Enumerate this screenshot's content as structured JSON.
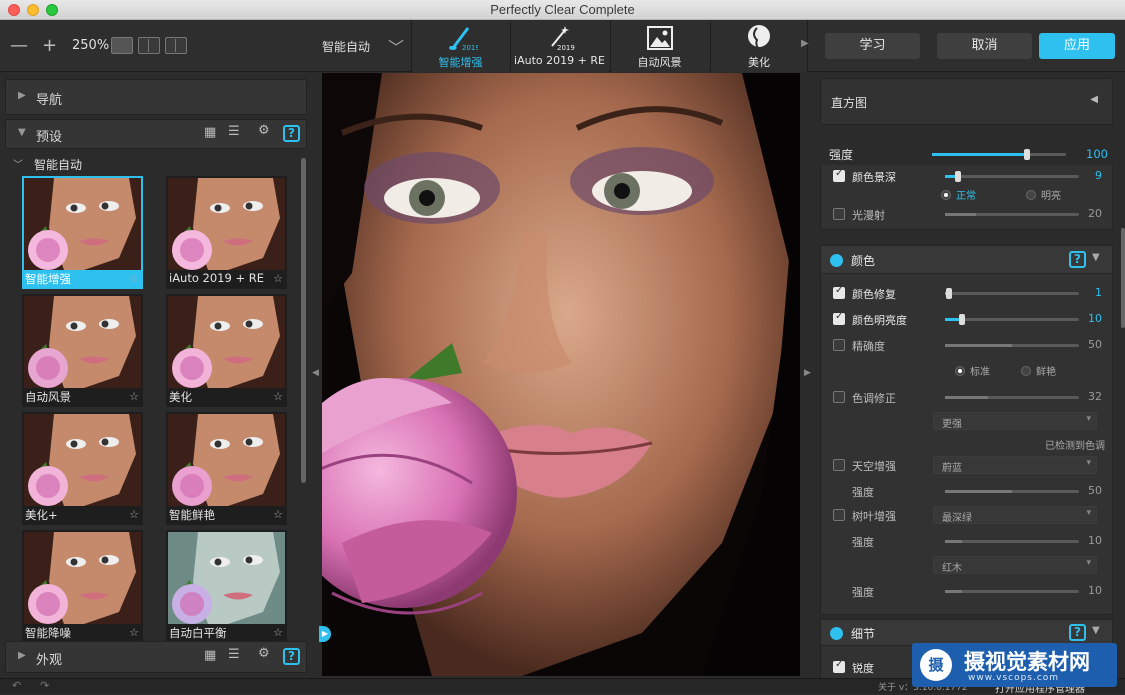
{
  "window": {
    "title": "Perfectly Clear Complete"
  },
  "toolbar": {
    "zoom_out": "—",
    "zoom_in": "+",
    "zoom_level": "250%",
    "preset_selector": "智能自动",
    "tabs": [
      {
        "label": "智能增强",
        "badge": "2019",
        "icon": "brush-2019-icon",
        "active": true
      },
      {
        "label": "iAuto 2019 + RE",
        "badge": "2019",
        "icon": "wand-2019-icon",
        "active": false
      },
      {
        "label": "自动风景",
        "icon": "landscape-icon",
        "active": false
      },
      {
        "label": "美化",
        "icon": "face-icon",
        "active": false
      }
    ],
    "learn_label": "学习",
    "cancel_label": "取消",
    "apply_label": "应用"
  },
  "left_panel": {
    "navigator": "导航",
    "presets": "预设",
    "presets_help": "?",
    "group": "智能自动",
    "thumbnails": [
      {
        "label": "智能增强",
        "selected": true
      },
      {
        "label": "iAuto 2019 + RE",
        "selected": false
      },
      {
        "label": "自动风景",
        "selected": false
      },
      {
        "label": "美化",
        "selected": false
      },
      {
        "label": "美化+",
        "selected": false
      },
      {
        "label": "智能鲜艳",
        "selected": false
      },
      {
        "label": "智能降噪",
        "selected": false
      },
      {
        "label": "自动白平衡",
        "selected": false
      }
    ],
    "star": "☆",
    "appearance": "外观",
    "appearance_help": "?"
  },
  "right_panel": {
    "histogram": "直方图",
    "strength_label": "强度",
    "strength_value": "100",
    "strength_level": 0.71,
    "sections": {
      "top": {
        "rows": [
          {
            "label": "颜色景深",
            "value": "9",
            "checked": true,
            "level": 0.1
          },
          {
            "label": "光漫射",
            "value": "20",
            "checked": false,
            "level": 0.23
          }
        ],
        "radio_normal": "正常",
        "radio_bright": "明亮"
      },
      "color": {
        "title": "颜色",
        "help": "?",
        "rows": [
          {
            "label": "颜色修复",
            "value": "1",
            "checked": true,
            "level": 0.03
          },
          {
            "label": "颜色明亮度",
            "value": "10",
            "checked": true,
            "level": 0.13
          },
          {
            "label": "精确度",
            "value": "50",
            "checked": false,
            "level": 0.5
          },
          {
            "label": "色调修正",
            "value": "32",
            "checked": false,
            "level": 0.32
          }
        ],
        "radio_standard": "标准",
        "radio_vivid": "鲜艳",
        "tone_dropdown": "更强",
        "detected_text": "已检测到色调",
        "sky_label": "天空增强",
        "sky_dropdown": "蔚蓝",
        "sky_strength_label": "强度",
        "sky_strength_value": "50",
        "sky_level": 0.5,
        "foliage_label": "树叶增强",
        "foliage_dropdown": "最深绿",
        "foliage_strength_label": "强度",
        "foliage_strength_value": "10",
        "foliage_level": 0.13,
        "wood_dropdown": "红木",
        "wood_strength_label": "强度",
        "wood_strength_value": "10",
        "wood_level": 0.13
      },
      "detail": {
        "title": "细节",
        "help": "?",
        "sharpen_label": "锐度"
      }
    }
  },
  "statusbar": {
    "version": "关于 v：3.10.0.1772",
    "open_manager": "打开应用程序管理器"
  },
  "watermark": {
    "text": "摄视觉素材网",
    "url": "www.vscops.com",
    "logo_char": "摄"
  },
  "colors": {
    "accent": "#2ec0ef",
    "panel": "#2b2b2b",
    "apply": "#2ec0ef"
  }
}
